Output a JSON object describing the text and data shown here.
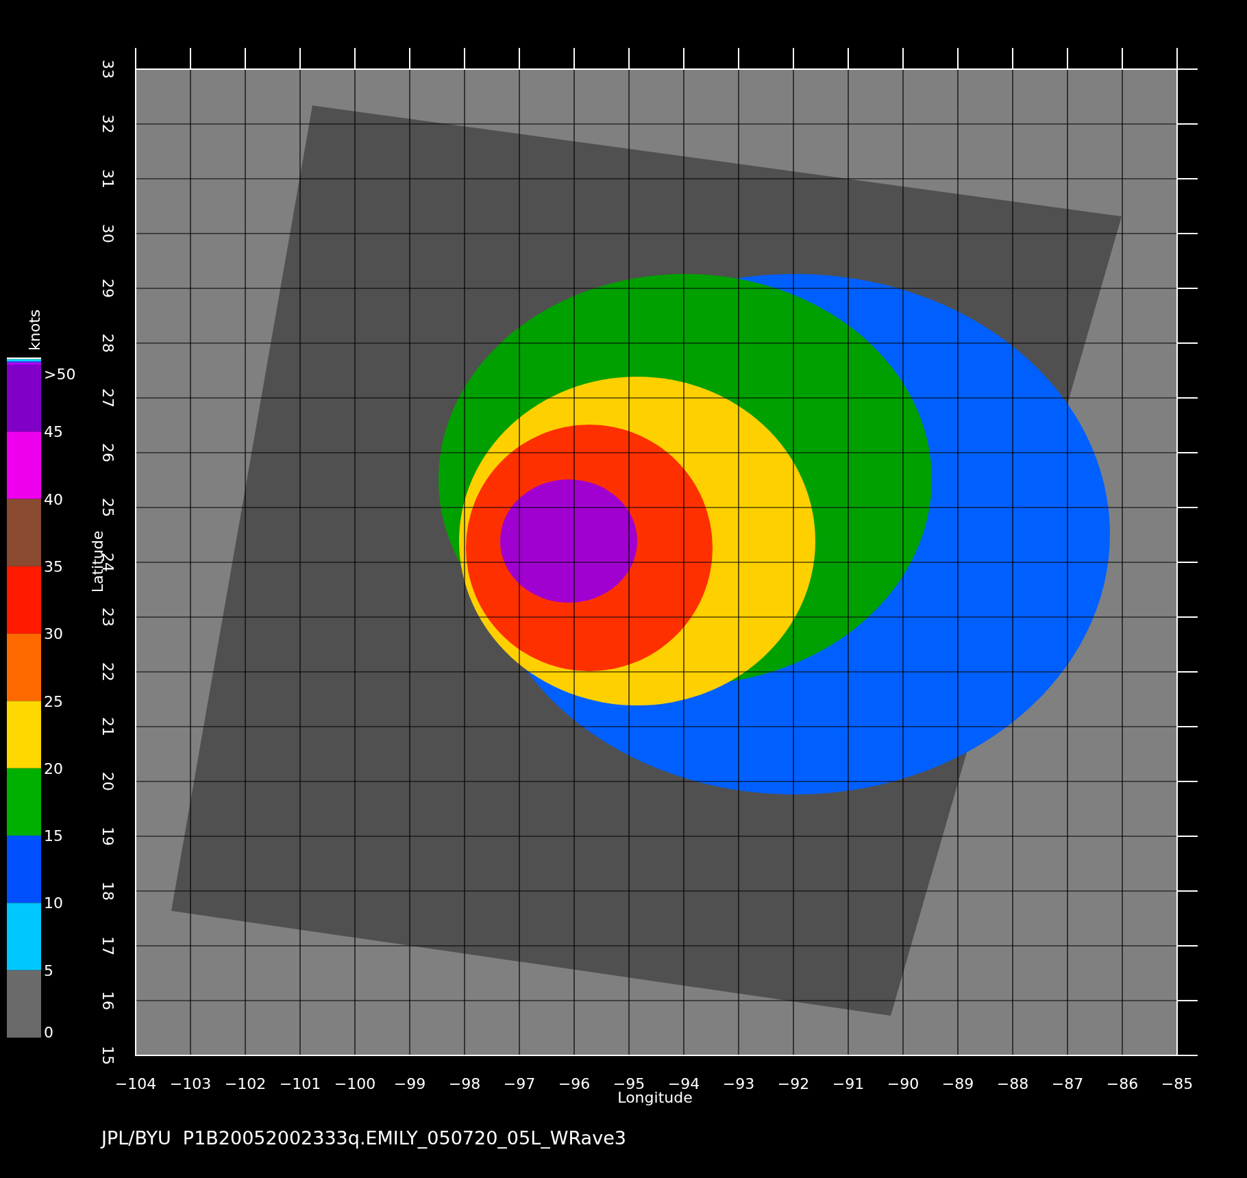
{
  "plot": {
    "xlabel": "Longitude",
    "ylabel": "Latitude",
    "xticks": [
      "−104",
      "−103",
      "−102",
      "−101",
      "−100",
      "−99",
      "−98",
      "−97",
      "−96",
      "−95",
      "−94",
      "−93",
      "−92",
      "−91",
      "−90",
      "−89",
      "−88",
      "−87",
      "−86",
      "−85"
    ],
    "yticks": [
      "33",
      "32",
      "31",
      "30",
      "29",
      "28",
      "27",
      "26",
      "25",
      "24",
      "23",
      "22",
      "21",
      "20",
      "19",
      "18",
      "17",
      "16",
      "15"
    ]
  },
  "colorbar": {
    "title": "knots",
    "labels": [
      ">50",
      "45",
      "40",
      "35",
      "30",
      "25",
      "20",
      "15",
      "10",
      "5",
      "0"
    ],
    "segments": [
      {
        "color": "#8000c8"
      },
      {
        "color": "#ee00ee"
      },
      {
        "color": "#8a4a30"
      },
      {
        "color": "#ff1a00"
      },
      {
        "color": "#ff6a00"
      },
      {
        "color": "#ffd800"
      },
      {
        "color": "#00b000"
      },
      {
        "color": "#0050ff"
      },
      {
        "color": "#00c8ff"
      },
      {
        "color": "#6a6a6a"
      }
    ]
  },
  "caption": "JPL/BYU  P1B20052002333q.EMILY_050720_05L_WRave3"
}
